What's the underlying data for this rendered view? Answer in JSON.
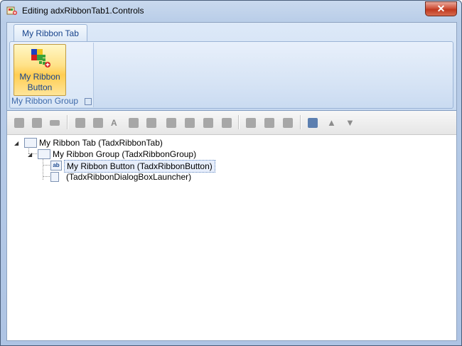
{
  "window": {
    "title": "Editing adxRibbonTab1.Controls",
    "close_label": "✕"
  },
  "ribbon": {
    "tab_label": "My Ribbon Tab",
    "group_label": "My Ribbon Group",
    "button_label_line1": "My Ribbon",
    "button_label_line2": "Button"
  },
  "toolbar": {
    "icons": [
      "add-tab-icon",
      "add-group-icon",
      "add-box-icon",
      "add-button-group-icon",
      "add-button-icon",
      "add-label-icon",
      "add-checkbox-icon",
      "add-editbox-icon",
      "add-combobox-icon",
      "add-dropdown-icon",
      "add-gallery-icon",
      "add-menu-icon",
      "add-splitbutton-icon",
      "add-separator-icon",
      "add-dialogbox-launcher-icon",
      "delete-icon",
      "move-up-icon",
      "move-down-icon"
    ]
  },
  "tree": {
    "nodes": [
      {
        "label": "My Ribbon Tab (TadxRibbonTab)",
        "icon": "ribbon-tab-icon"
      },
      {
        "label": "My Ribbon Group (TadxRibbonGroup)",
        "icon": "ribbon-group-icon"
      },
      {
        "label": "My Ribbon Button (TadxRibbonButton)",
        "icon": "ribbon-button-icon",
        "selected": true
      },
      {
        "label": "(TadxRibbonDialogBoxLauncher)",
        "icon": "dialog-launcher-icon"
      }
    ]
  },
  "colors": {
    "accent": "#15428b",
    "selected_button": "#ffd66a",
    "close_button": "#c0391f"
  }
}
